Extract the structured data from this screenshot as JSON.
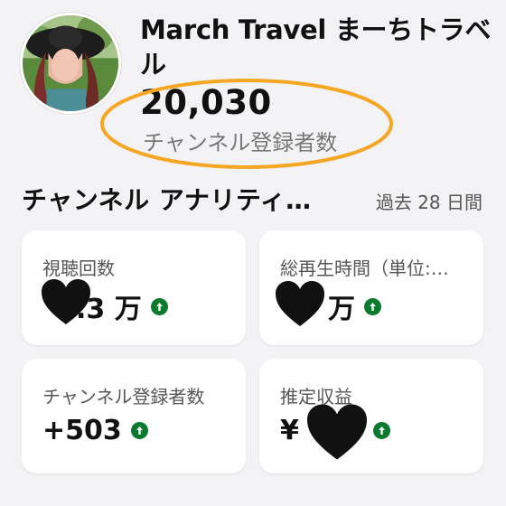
{
  "channel": {
    "name": "March Travel まーちトラベル",
    "subscriber_count": "20,030",
    "subscriber_label": "チャンネル登録者数"
  },
  "analytics": {
    "title": "チャンネル アナリティ…",
    "period": "過去 28 日間",
    "cards": [
      {
        "label": "視聴回数",
        "value": ".3 万",
        "trend": "up"
      },
      {
        "label": "総再生時間（単位:…",
        "value": "万",
        "trend": "up"
      },
      {
        "label": "チャンネル登録者数",
        "value": "+503",
        "trend": "up"
      },
      {
        "label": "推定収益",
        "value": "¥",
        "trend": "up"
      }
    ]
  },
  "icons": {
    "trend": "arrow-up-circle-icon",
    "redaction": "black-heart-icon"
  },
  "colors": {
    "highlight": "#f5a623",
    "trend_up": "#0a7a2f",
    "background": "#f3f3f5",
    "card": "#ffffff"
  }
}
